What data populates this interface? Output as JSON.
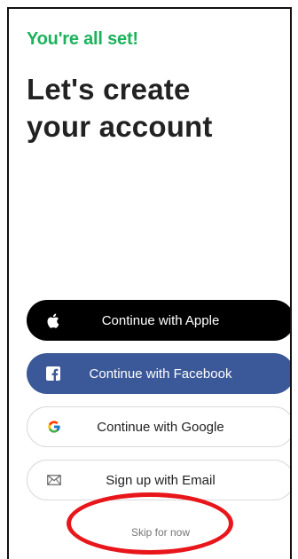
{
  "header": {
    "subtitle": "You're all set!",
    "title_line1": "Let's create",
    "title_line2": "your account"
  },
  "buttons": {
    "apple": {
      "label": "Continue with Apple",
      "icon": "apple-icon"
    },
    "facebook": {
      "label": "Continue with Facebook",
      "icon": "facebook-icon"
    },
    "google": {
      "label": "Continue with Google",
      "icon": "google-icon"
    },
    "email": {
      "label": "Sign up with Email",
      "icon": "mail-icon"
    }
  },
  "skip": {
    "label": "Skip for now"
  },
  "colors": {
    "accent": "#1bb35a",
    "apple_bg": "#000000",
    "facebook_bg": "#3b5998",
    "annotation": "#e8161b"
  }
}
